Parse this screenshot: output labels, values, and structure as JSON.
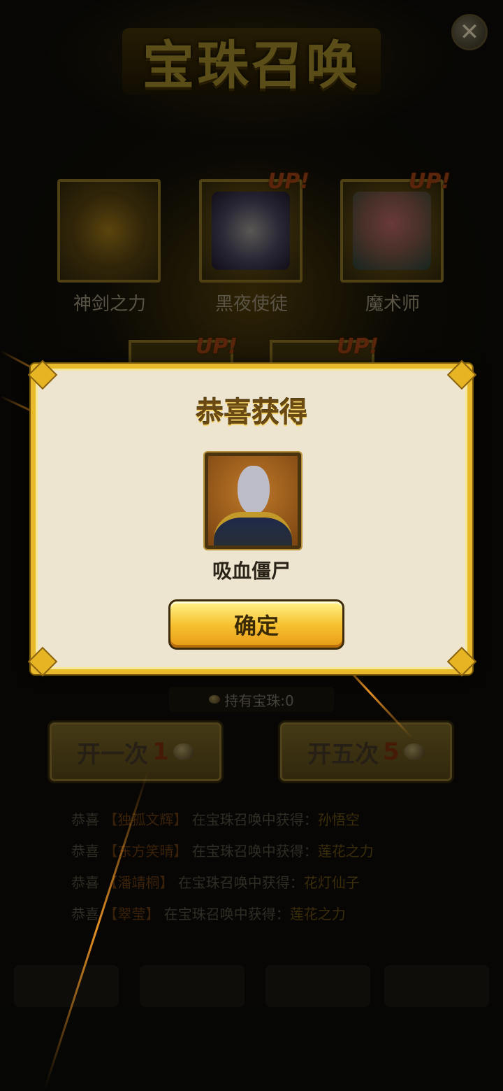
{
  "header": {
    "title": "宝珠召唤",
    "close_icon": "close-icon"
  },
  "featured": [
    {
      "name": "神剑之力",
      "up": ""
    },
    {
      "name": "黑夜使徒",
      "up": "UP!"
    },
    {
      "name": "魔术师",
      "up": "UP!"
    }
  ],
  "featured_row2": [
    {
      "up": "UP!"
    },
    {
      "up": "UP!"
    }
  ],
  "modal": {
    "title": "恭喜获得",
    "reward_name": "吸血僵尸",
    "confirm_label": "确定"
  },
  "holdings_label": "持有宝珠:0",
  "buttons": {
    "once": {
      "label": "开一次",
      "cost": "1"
    },
    "five": {
      "label": "开五次",
      "cost": "5"
    }
  },
  "feed": [
    {
      "prefix": "恭喜",
      "who": "【独孤文辉】",
      "mid": "在宝珠召唤中获得：",
      "item": "孙悟空"
    },
    {
      "prefix": "恭喜",
      "who": "【东方笑晴】",
      "mid": "在宝珠召唤中获得：",
      "item": "莲花之力"
    },
    {
      "prefix": "恭喜",
      "who": "【潘靖桐】",
      "mid": "在宝珠召唤中获得：",
      "item": "花灯仙子"
    },
    {
      "prefix": "恭喜",
      "who": "【翠莹】",
      "mid": "在宝珠召唤中获得：",
      "item": "莲花之力"
    }
  ],
  "colors": {
    "gold": "#e8b92a",
    "panel": "#ede5cf"
  }
}
